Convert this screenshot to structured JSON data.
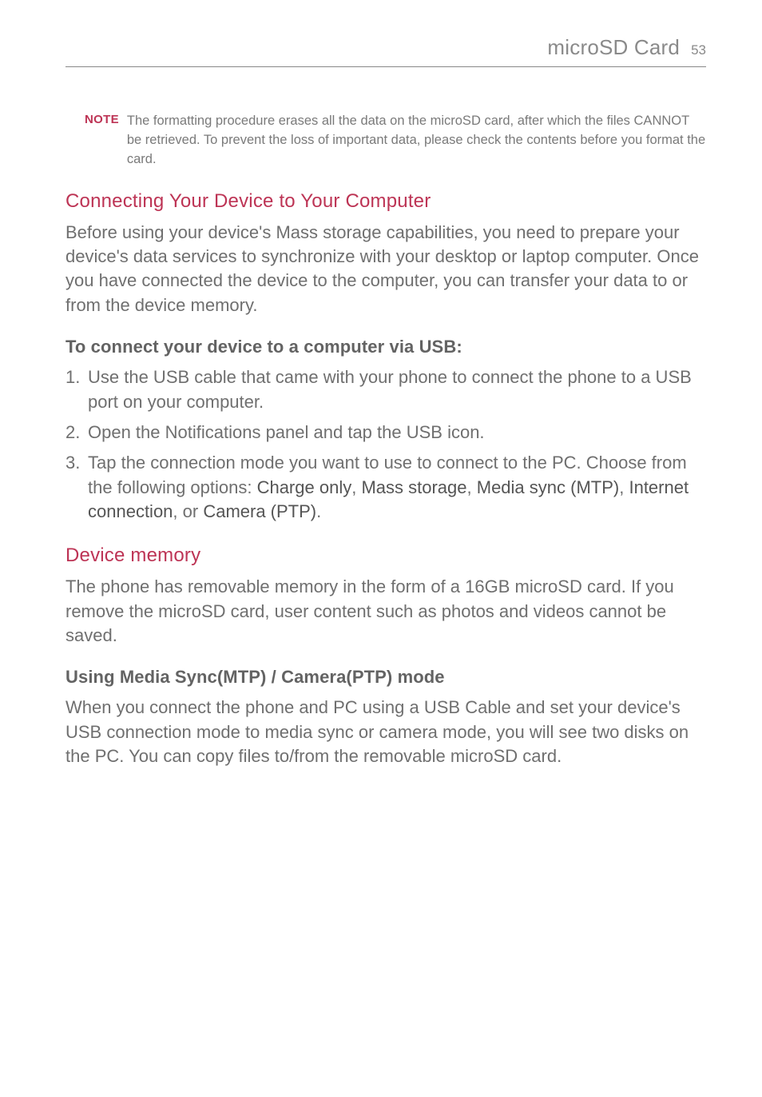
{
  "header": {
    "title": "microSD Card",
    "page_number": "53"
  },
  "note": {
    "label": "NOTE",
    "text": "The formatting procedure erases all the data on the microSD card, after which the files CANNOT be retrieved. To prevent the loss of important data, please check the contents before you format the card."
  },
  "section1": {
    "heading": "Connecting Your Device to Your Computer",
    "para": "Before using your device's Mass storage capabilities, you need to prepare your device's data services to synchronize with your desktop or laptop computer. Once you have connected the device to the computer, you can transfer your data to or from the device memory."
  },
  "subheading1": "To connect your device to a computer via USB:",
  "list": {
    "item1": "Use the USB cable that came with your phone to connect the phone to a USB port on your computer.",
    "item2": "Open the Notifications panel and tap the USB icon.",
    "item3_prefix": "Tap the connection mode you want to use to connect to the PC. Choose from the following options: ",
    "opt1": "Charge only",
    "sep1": ", ",
    "opt2": "Mass storage",
    "sep2": ", ",
    "opt3": "Media sync (MTP)",
    "sep3": ", ",
    "opt4": "Internet connection",
    "sep4": ", or ",
    "opt5": "Camera (PTP)",
    "item3_suffix": "."
  },
  "section2": {
    "heading": "Device memory",
    "para": "The phone has removable memory in the form of a 16GB microSD card. If you remove the microSD card, user content such as photos and videos cannot be saved."
  },
  "subheading2": "Using Media Sync(MTP) / Camera(PTP) mode",
  "para3": "When you connect the phone and PC using a USB Cable and set your device's USB connection mode to media sync or camera mode, you will see two disks on the PC. You can copy files to/from the removable microSD card."
}
